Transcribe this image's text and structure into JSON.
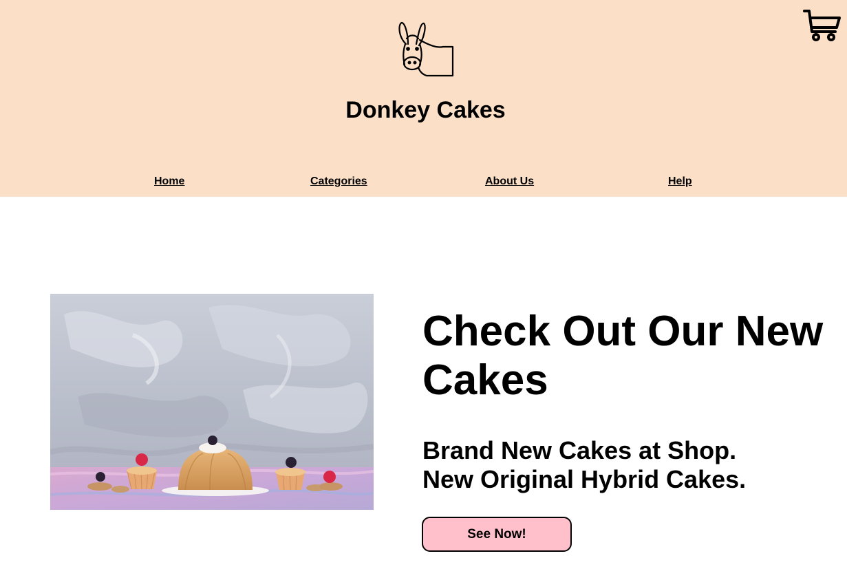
{
  "header": {
    "logo_icon": "donkey-logo-icon",
    "brand_title": "Donkey Cakes",
    "cart_icon": "shopping-cart-icon",
    "background_color": "#fbdfc6"
  },
  "nav": {
    "items": [
      {
        "label": "Home"
      },
      {
        "label": "Categories"
      },
      {
        "label": "About Us"
      },
      {
        "label": "Help"
      }
    ]
  },
  "hero": {
    "image_subject": "cakes-and-cupcakes-photo",
    "headline": "Check Out Our New Cakes",
    "subline_1": "Brand New Cakes at Shop.",
    "subline_2": "New Original Hybrid Cakes.",
    "cta_label": "See Now!",
    "cta_color": "#ffc0cb"
  }
}
